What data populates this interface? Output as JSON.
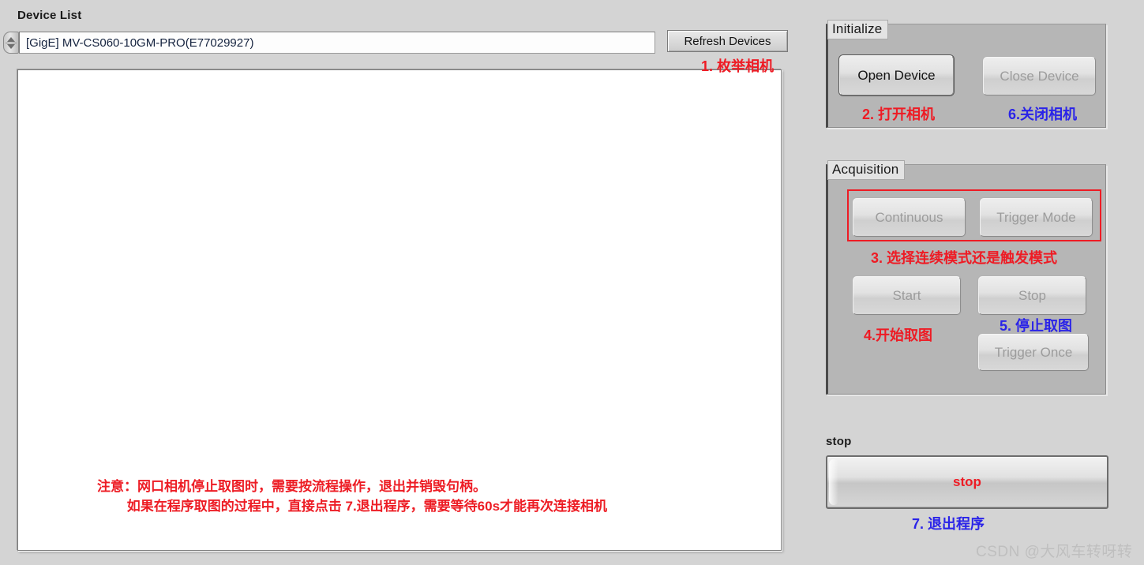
{
  "device_section": {
    "label": "Device List",
    "selected_device": "[GigE]  MV-CS060-10GM-PRO(E77029927)",
    "refresh_label": "Refresh Devices",
    "spinner_icon": "updown-arrows-icon",
    "annotation_refresh": "1. 枚举相机"
  },
  "display": {
    "note_line1": "注意：网口相机停止取图时，需要按流程操作，退出并销毁句柄。",
    "note_line2": "        如果在程序取图的过程中，直接点击 7.退出程序，需要等待60s才能再次连接相机"
  },
  "initialize": {
    "title": "Initialize",
    "open_device": "Open Device",
    "close_device": "Close Device",
    "annotation_open": "2. 打开相机",
    "annotation_close": "6.关闭相机"
  },
  "acquisition": {
    "title": "Acquisition",
    "continuous": "Continuous",
    "trigger_mode": "Trigger Mode",
    "start": "Start",
    "stop": "Stop",
    "trigger_once": "Trigger Once",
    "annotation_mode": "3. 选择连续模式还是触发模式",
    "annotation_start": "4.开始取图",
    "annotation_stop": "5. 停止取图"
  },
  "stop_section": {
    "label": "stop",
    "button_label": "stop",
    "annotation_exit": "7. 退出程序"
  },
  "watermark": {
    "text": "CSDN @大风车转呀转"
  },
  "colors": {
    "annotation_red": "#ee1b24",
    "annotation_blue": "#2a23e8",
    "panel_background": "#d4d4d4",
    "group_background": "#b6b6b6",
    "stop_text": "#ee1b24"
  }
}
